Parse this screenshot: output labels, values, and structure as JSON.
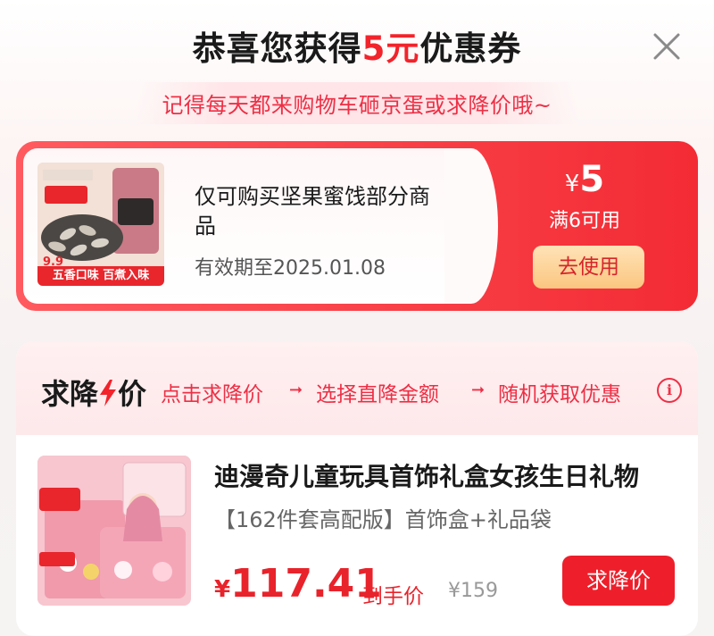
{
  "header": {
    "title_prefix": "恭喜您获得",
    "title_amount": "5元",
    "title_suffix": "优惠券",
    "subtitle": "记得每天都来购物车砸京蛋或求降价哦~"
  },
  "coupon": {
    "description": "仅可购买坚果蜜饯部分商品",
    "validity": "有效期至2025.01.08",
    "currency": "¥",
    "value": "5",
    "condition": "满6可用",
    "use_label": "去使用",
    "thumb_banner": "五香口味 百煮入味",
    "thumb_price": "9.9"
  },
  "bargain": {
    "title_a": "求降",
    "title_b": "价",
    "steps": [
      "点击求降价",
      "选择直降金额",
      "随机获取优惠"
    ],
    "arrow": "➞",
    "info_glyph": "i",
    "product": {
      "name": "迪漫奇儿童玩具首饰礼盒女孩生日礼物",
      "spec": "【162件套高配版】首饰盒+礼品袋",
      "currency": "¥",
      "price": "117.41",
      "final_label": "到手价",
      "original_price": "¥159",
      "button_label": "求降价"
    }
  },
  "colors": {
    "accent": "#f2232b",
    "coupon_gradient_start": "#ff5a5f",
    "button_gold": "#fbc680"
  },
  "icons": [
    "close-icon",
    "info-icon",
    "lightning-icon"
  ]
}
